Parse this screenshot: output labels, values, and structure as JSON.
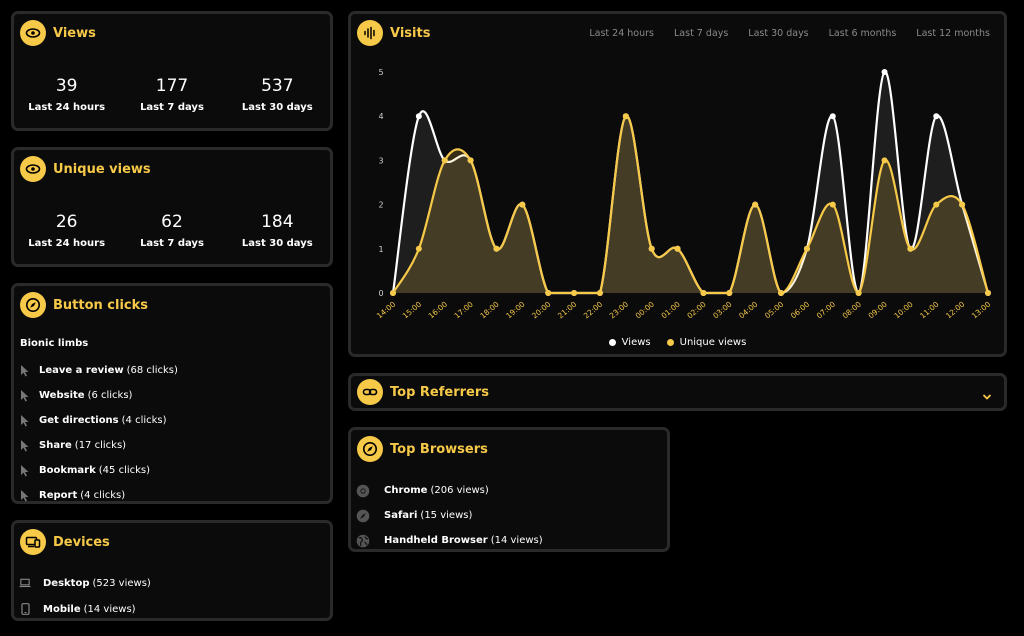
{
  "views": {
    "title": "Views",
    "stats": [
      {
        "value": "39",
        "label": "Last 24 hours"
      },
      {
        "value": "177",
        "label": "Last 7 days"
      },
      {
        "value": "537",
        "label": "Last 30 days"
      }
    ]
  },
  "unique_views": {
    "title": "Unique views",
    "stats": [
      {
        "value": "26",
        "label": "Last 24 hours"
      },
      {
        "value": "62",
        "label": "Last 7 days"
      },
      {
        "value": "184",
        "label": "Last 30 days"
      }
    ]
  },
  "button_clicks": {
    "title": "Button clicks",
    "heading": "Bionic limbs",
    "items": [
      {
        "name": "Leave a review",
        "count": "(68 clicks)"
      },
      {
        "name": "Website",
        "count": "(6 clicks)"
      },
      {
        "name": "Get directions",
        "count": "(4 clicks)"
      },
      {
        "name": "Share",
        "count": "(17 clicks)"
      },
      {
        "name": "Bookmark",
        "count": "(45 clicks)"
      },
      {
        "name": "Report",
        "count": "(4 clicks)"
      }
    ]
  },
  "devices": {
    "title": "Devices",
    "items": [
      {
        "name": "Desktop",
        "count": "(523 views)",
        "icon": "laptop-icon"
      },
      {
        "name": "Mobile",
        "count": "(14 views)",
        "icon": "mobile-icon"
      }
    ]
  },
  "visits": {
    "title": "Visits",
    "tabs": [
      "Last 24 hours",
      "Last 7 days",
      "Last 30 days",
      "Last 6 months",
      "Last 12 months"
    ]
  },
  "top_referrers": {
    "title": "Top Referrers"
  },
  "top_browsers": {
    "title": "Top Browsers",
    "items": [
      {
        "name": "Chrome",
        "count": "(206 views)",
        "icon": "chrome-icon"
      },
      {
        "name": "Safari",
        "count": "(15 views)",
        "icon": "safari-icon"
      },
      {
        "name": "Handheld Browser",
        "count": "(14 views)",
        "icon": "globe-icon"
      }
    ]
  },
  "colors": {
    "accent": "#f7c948",
    "views_line": "#ffffff",
    "card_border": "#2a2a2a",
    "background": "#000000"
  },
  "chart_data": {
    "type": "area",
    "x": [
      "14:00",
      "15:00",
      "16:00",
      "17:00",
      "18:00",
      "19:00",
      "20:00",
      "21:00",
      "22:00",
      "23:00",
      "00:00",
      "01:00",
      "02:00",
      "03:00",
      "04:00",
      "05:00",
      "06:00",
      "07:00",
      "08:00",
      "09:00",
      "10:00",
      "11:00",
      "12:00",
      "13:00"
    ],
    "series": [
      {
        "name": "Views",
        "color": "#ffffff",
        "values": [
          0,
          4,
          3,
          3,
          1,
          2,
          0,
          0,
          0,
          4,
          1,
          1,
          0,
          0,
          2,
          0,
          1,
          4,
          0,
          5,
          1,
          4,
          2,
          0
        ]
      },
      {
        "name": "Unique views",
        "color": "#f7c948",
        "values": [
          0,
          1,
          3,
          3,
          1,
          2,
          0,
          0,
          0,
          4,
          1,
          1,
          0,
          0,
          2,
          0,
          1,
          2,
          0,
          3,
          1,
          2,
          2,
          0
        ]
      }
    ],
    "yticks": [
      "0",
      "1",
      "2",
      "3",
      "4",
      "5"
    ],
    "ylim": [
      0,
      5
    ],
    "legend": "bottom"
  }
}
